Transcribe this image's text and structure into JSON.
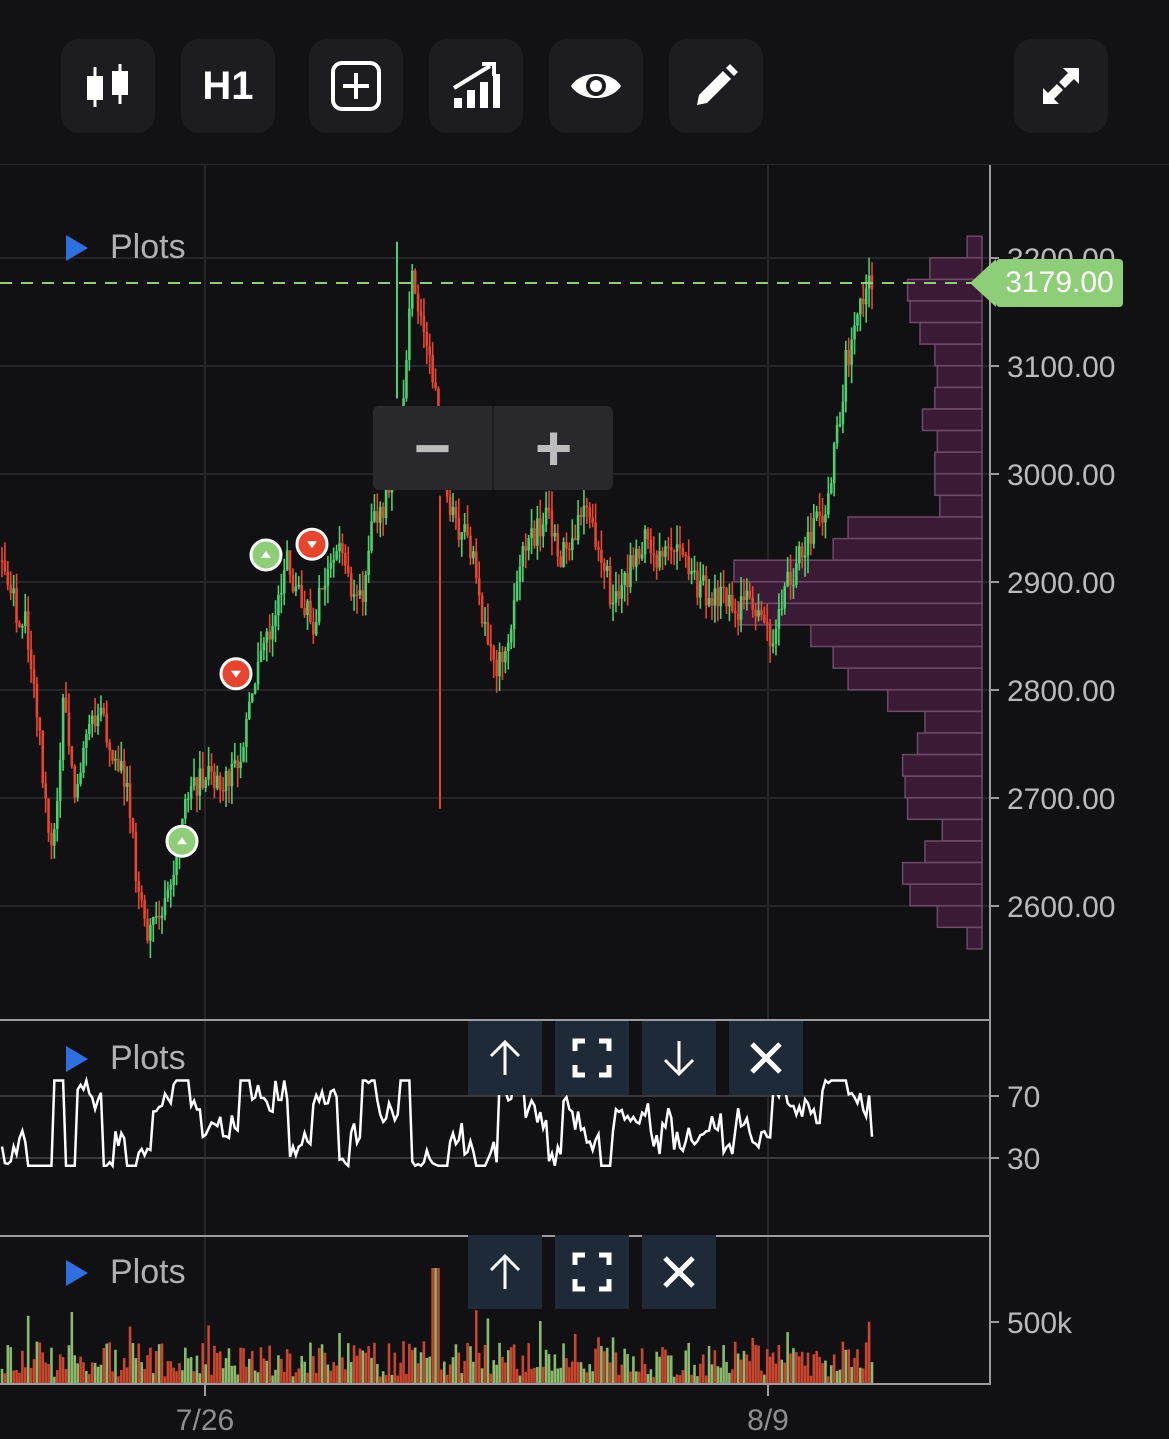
{
  "toolbar": {
    "buttons": [
      {
        "name": "chart-type",
        "icon": "candlestick-icon"
      },
      {
        "name": "timeframe",
        "label": "H1"
      },
      {
        "name": "add-indicator",
        "icon": "plus-square-icon"
      },
      {
        "name": "studies",
        "icon": "bar-chart-rising-icon"
      },
      {
        "name": "visibility",
        "icon": "eye-icon"
      },
      {
        "name": "drawing",
        "icon": "pencil-icon"
      },
      {
        "name": "fullscreen",
        "icon": "expand-arrows-icon"
      }
    ],
    "timeframe_label": "H1"
  },
  "colors": {
    "up": "#4ccf6e",
    "down": "#e8452f",
    "profile": "#3a1a34",
    "profile_border": "#6e4a68",
    "last_price": "#8fce78",
    "button_bg": "#1f2a38",
    "plots_arrow": "#2f6fe0"
  },
  "main_pane": {
    "plots_label": "Plots",
    "last_price": "3179.00",
    "price_axis": [
      "3200.00",
      "3100.00",
      "3000.00",
      "2900.00",
      "2800.00",
      "2700.00",
      "2600.00"
    ],
    "zoom_out_label": "−",
    "zoom_in_label": "+"
  },
  "oscillator_pane": {
    "plots_label": "Plots",
    "axis": [
      "70",
      "30"
    ],
    "controls": [
      "move-up",
      "maximize",
      "move-down",
      "close"
    ]
  },
  "volume_pane": {
    "plots_label": "Plots",
    "axis": [
      "500k"
    ],
    "controls": [
      "move-up",
      "maximize",
      "close"
    ]
  },
  "time_axis": [
    "7/26",
    "8/9"
  ],
  "chart_data": {
    "type": "candlestick",
    "timeframe": "H1",
    "ylim": [
      2560,
      3230
    ],
    "y_ticks": [
      2600,
      2700,
      2800,
      2900,
      3000,
      3100,
      3200
    ],
    "x_ticks": [
      "7/26",
      "8/9"
    ],
    "last_price": 3179.0,
    "price_path": [
      2920,
      2880,
      2860,
      2760,
      2640,
      2800,
      2700,
      2760,
      2790,
      2730,
      2720,
      2600,
      2570,
      2600,
      2640,
      2700,
      2720,
      2720,
      2720,
      2720,
      2800,
      2840,
      2870,
      2920,
      2880,
      2860,
      2900,
      2940,
      2900,
      2890,
      2960,
      2980,
      3000,
      3180,
      3120,
      3080,
      2960,
      2950,
      2920,
      2850,
      2820,
      2870,
      2930,
      2950,
      2960,
      2920,
      2950,
      2960,
      2940,
      2890,
      2900,
      2920,
      2940,
      2920,
      2930,
      2910,
      2900,
      2880,
      2890,
      2870,
      2880,
      2860,
      2840,
      2890,
      2920,
      2940,
      2960,
      3020,
      3110,
      3150,
      3179
    ],
    "volume_profile_price_levels": [
      3210,
      3190,
      3170,
      3150,
      3130,
      3110,
      3090,
      3070,
      3050,
      3030,
      3010,
      2990,
      2970,
      2950,
      2930,
      2910,
      2890,
      2870,
      2850,
      2830,
      2810,
      2790,
      2770,
      2750,
      2730,
      2710,
      2690,
      2670,
      2650,
      2630,
      2610,
      2590,
      2570
    ],
    "volume_profile_relative": [
      0.06,
      0.21,
      0.3,
      0.29,
      0.25,
      0.19,
      0.18,
      0.19,
      0.24,
      0.18,
      0.19,
      0.19,
      0.17,
      0.54,
      0.6,
      1.0,
      0.96,
      0.98,
      0.69,
      0.6,
      0.54,
      0.38,
      0.23,
      0.26,
      0.32,
      0.31,
      0.3,
      0.16,
      0.23,
      0.32,
      0.29,
      0.18,
      0.06
    ],
    "signals": [
      {
        "type": "buy",
        "price": 2660
      },
      {
        "type": "sell",
        "price": 2815
      },
      {
        "type": "buy",
        "price": 2925
      },
      {
        "type": "sell",
        "price": 2935
      }
    ],
    "oscillator": {
      "levels": [
        70,
        30
      ]
    },
    "volume_axis_label": "500k"
  }
}
